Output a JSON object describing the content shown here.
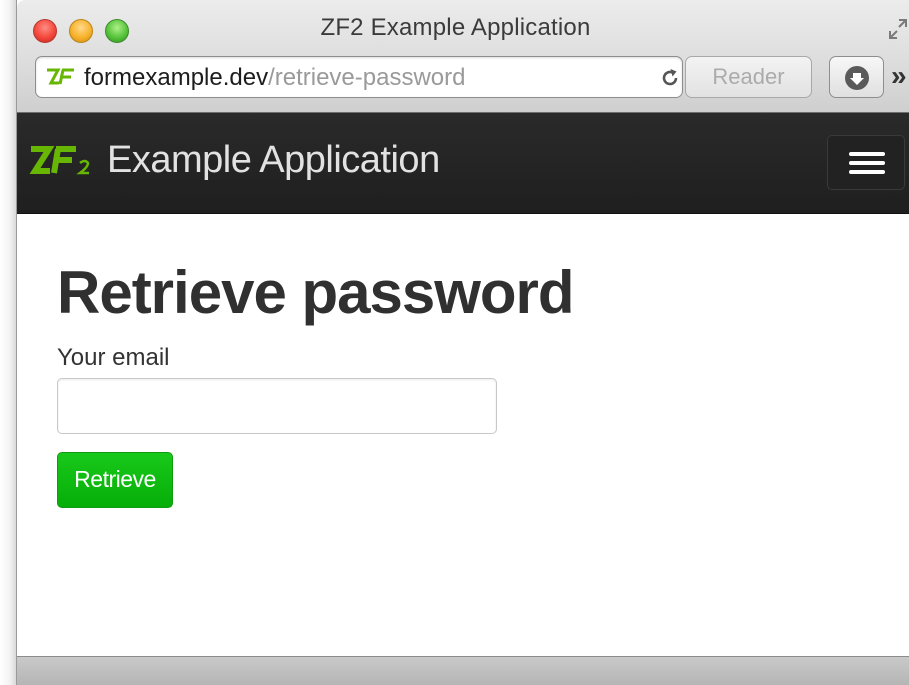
{
  "window": {
    "title": "ZF2 Example Application"
  },
  "toolbar": {
    "url_domain": "formexample.dev",
    "url_path": "/retrieve-password",
    "reader_label": "Reader",
    "more_label": "»"
  },
  "navbar": {
    "brand_name": "Example Application",
    "brand_logo_color": "#68b604"
  },
  "form": {
    "title": "Retrieve password",
    "email_label": "Your email",
    "email_value": "",
    "submit_label": "Retrieve",
    "submit_color": "#0cbb0e"
  },
  "icons": {
    "close": "close-icon",
    "minimize": "minimize-icon",
    "maximize": "zoom-icon",
    "fullscreen": "fullscreen-icon",
    "favicon": "zf2-favicon",
    "reload": "reload-icon",
    "download": "download-icon",
    "menu": "hamburger-icon"
  }
}
